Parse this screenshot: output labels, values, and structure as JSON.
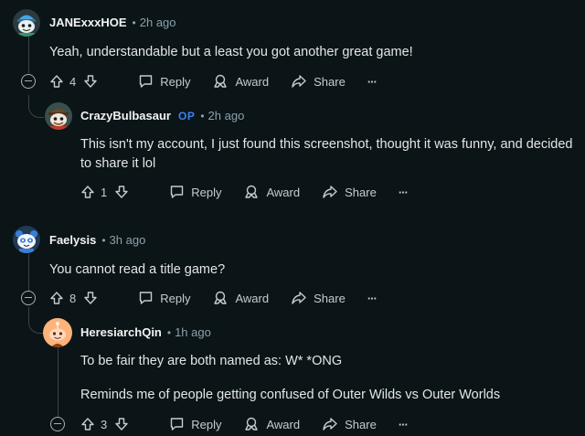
{
  "comments": [
    {
      "author": "JANExxxHOE",
      "time": "2h ago",
      "body": "Yeah, understandable but a least you got another great game!",
      "votes": "4",
      "avatar": "snoo-avatar-blue-cap"
    },
    {
      "author": "CrazyBulbasaur",
      "op_badge": "OP",
      "time": "2h ago",
      "body": "This isn't my account, I just found this screenshot, thought it was funny, and decided to share it lol",
      "votes": "1",
      "avatar": "snoo-avatar-brown-hat"
    },
    {
      "author": "Faelysis",
      "time": "3h ago",
      "body": "You cannot read a title game?",
      "votes": "8",
      "avatar": "snoo-avatar-blue-panda"
    },
    {
      "author": "HeresiarchQin",
      "time": "1h ago",
      "body_line1": "To be fair they are both named as: W* *ONG",
      "body_line2": "Reminds me of people getting confused of Outer Wilds vs Outer Worlds",
      "votes": "3",
      "avatar": "default-snoo-orange"
    }
  ],
  "labels": {
    "reply": "Reply",
    "award": "Award",
    "share": "Share",
    "more": "···"
  },
  "colors": {
    "background": "#0b1416",
    "op_badge": "#3b82f6",
    "meta_text": "#8ba2ad"
  }
}
